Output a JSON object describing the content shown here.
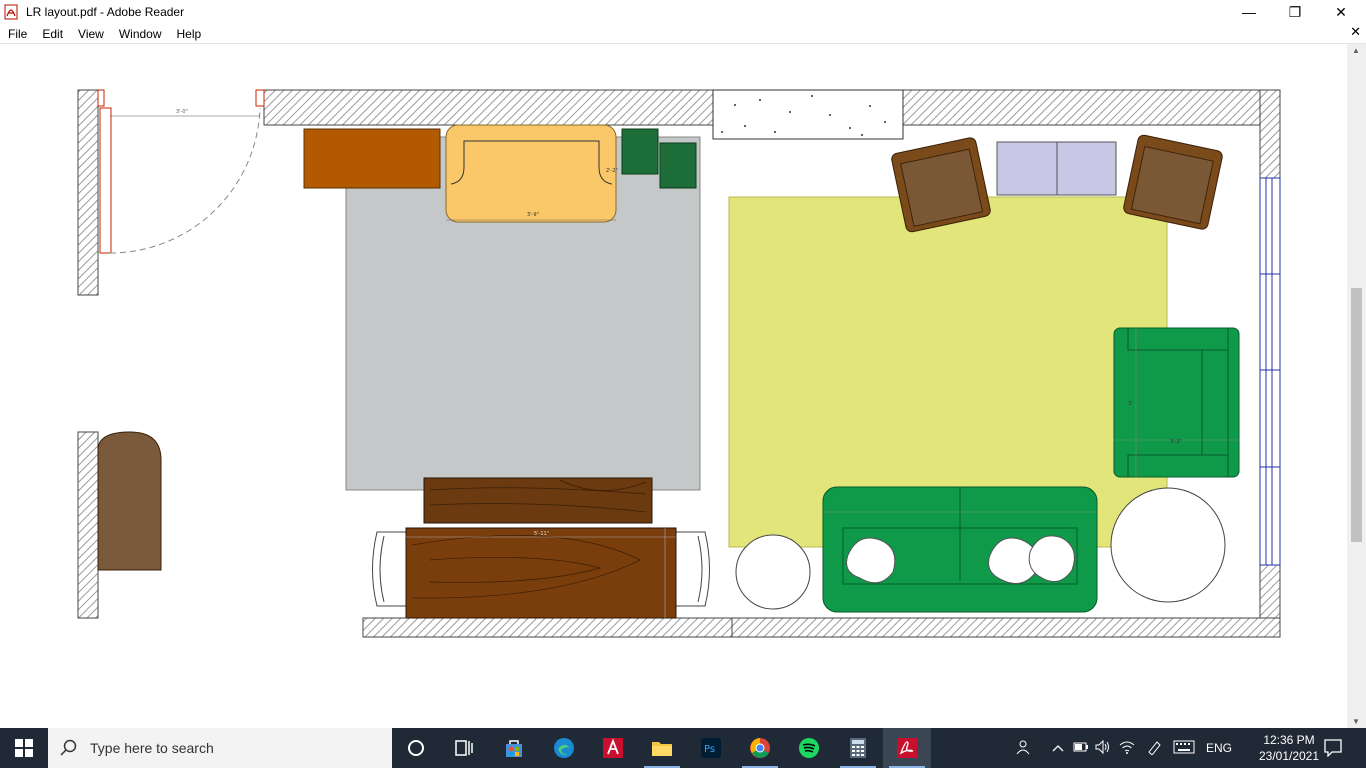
{
  "window": {
    "title": "LR layout.pdf - Adobe Reader",
    "controls": {
      "minimize": "—",
      "restore": "❐",
      "close": "✕"
    }
  },
  "menu": {
    "items": [
      "File",
      "Edit",
      "View",
      "Window",
      "Help"
    ],
    "close_label": "✕"
  },
  "plan": {
    "door_dim": "3'-0\"",
    "sofa_width_dim": "3'-9\"",
    "sofa_depth_dim": "2'-2\"",
    "table_dim": "5'-11\"",
    "armchair_depth_dim": "3'",
    "armchair_width_dim": "3'-3\"",
    "colors": {
      "wall_hatch": "#9a9a9a",
      "bed": "#c4c8c9",
      "rug": "#e1e57a",
      "orange_cabinet": "#b35a00",
      "yellow_sofa": "#fbc869",
      "green_block": "#1e6e3a",
      "green_sofa": "#0f9a4a",
      "brown_armchair": "#7a4a1a",
      "lavender_cabinet": "#c8c8e6",
      "wood_dark": "#6b3a10",
      "door_red": "#cc2200",
      "window_blue": "#2233aa"
    }
  },
  "taskbar": {
    "search_placeholder": "Type here to search",
    "icons": [
      "cortana-icon",
      "task-view-icon",
      "store-icon",
      "edge-icon",
      "autocad-icon",
      "file-explorer-icon",
      "photoshop-icon",
      "chrome-icon",
      "spotify-icon",
      "calculator-icon",
      "acrobat-icon"
    ],
    "tray": {
      "language": "ENG",
      "time": "12:36 PM",
      "date": "23/01/2021"
    }
  }
}
